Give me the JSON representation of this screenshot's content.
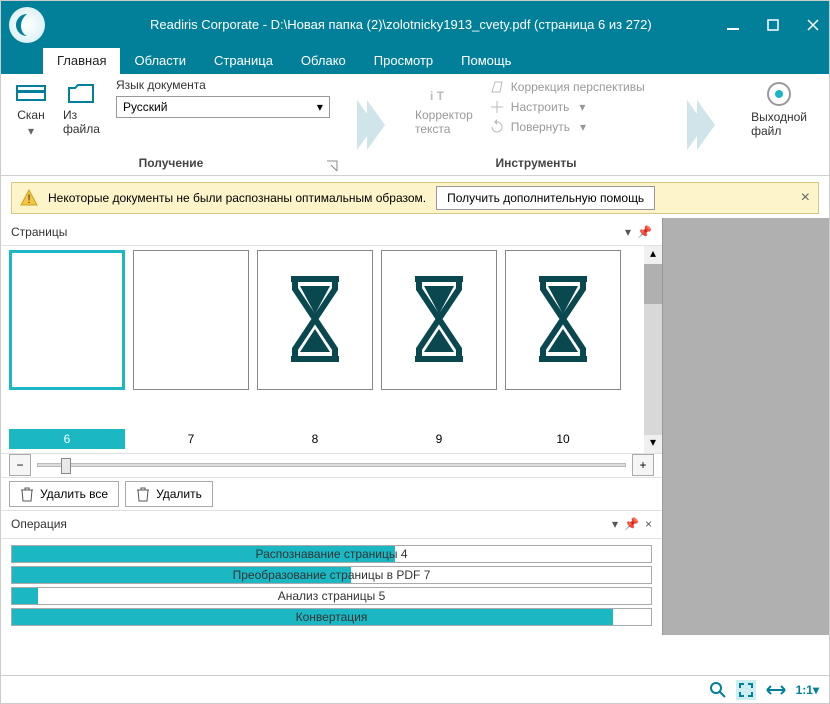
{
  "title": "Readiris Corporate - D:\\Новая папка (2)\\zolotnicky1913_cvety.pdf (страница 6 из 272)",
  "tabs": [
    "Главная",
    "Области",
    "Страница",
    "Облако",
    "Просмотр",
    "Помощь"
  ],
  "ribbon": {
    "scan": "Скан",
    "fromfile": "Из\nфайла",
    "langlabel": "Язык документа",
    "langval": "Русский",
    "group1": "Получение",
    "corrector": "Корректор\nтекста",
    "perspective": "Коррекция перспективы",
    "adjust": "Настроить",
    "rotate": "Повернуть",
    "group2": "Инструменты",
    "output": "Выходной\nфайл"
  },
  "warning": {
    "text": "Некоторые документы не были распознаны оптимальным образом.",
    "btn": "Получить дополнительную помощь"
  },
  "pages_hdr": "Страницы",
  "thumbs": [
    {
      "num": "6",
      "kind": "text"
    },
    {
      "num": "7",
      "kind": "text"
    },
    {
      "num": "8",
      "kind": "wait"
    },
    {
      "num": "9",
      "kind": "wait"
    },
    {
      "num": "10",
      "kind": "wait"
    }
  ],
  "delete_all": "Удалить все",
  "delete": "Удалить",
  "op_hdr": "Операция",
  "ops": [
    {
      "label": "Распознавание страницы 4",
      "pct": 60
    },
    {
      "label": "Преобразование страницы в PDF 7",
      "pct": 53
    },
    {
      "label": "Анализ страницы 5",
      "pct": 4
    },
    {
      "label": "Конвертация",
      "pct": 94
    }
  ],
  "status": {
    "zoom": "1:1"
  }
}
